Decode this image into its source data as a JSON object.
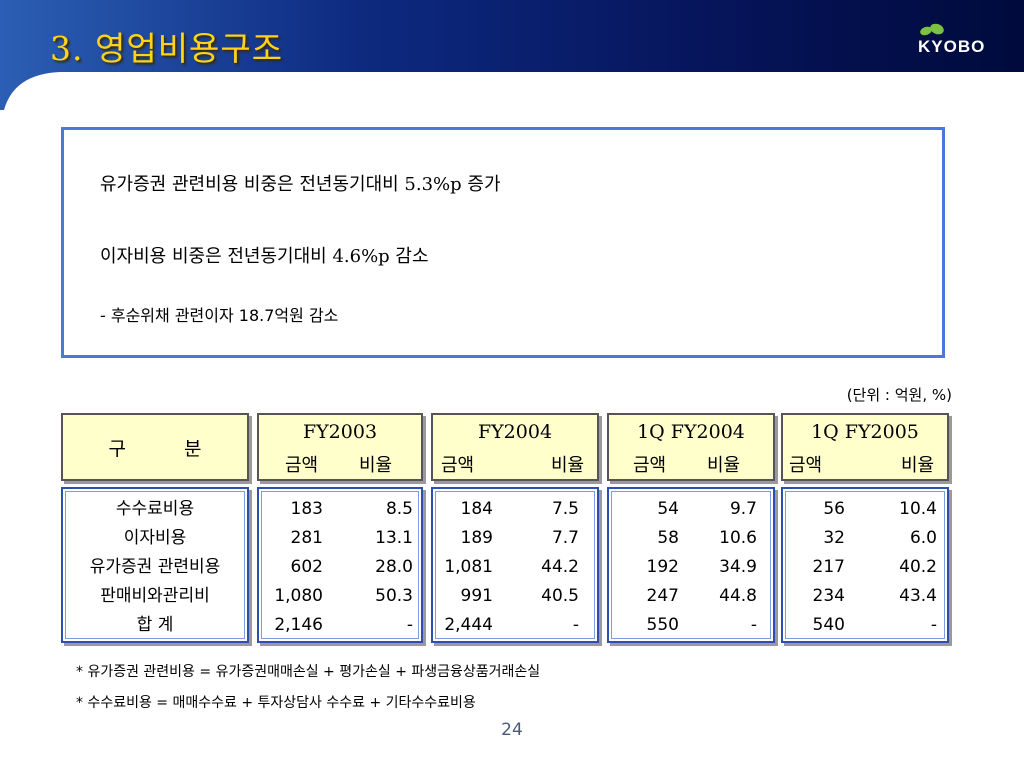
{
  "header": {
    "title": "3. 영업비용구조",
    "logo_text": "KYOBO"
  },
  "summary": {
    "line1": "유가증권 관련비용 비중은 전년동기대비 5.3%p 증가",
    "line2": "이자비용 비중은 전년동기대비 4.6%p 감소",
    "line3": "- 후순위채 관련이자 18.7억원 감소"
  },
  "table": {
    "unit": "(단위 : 억원, %)",
    "category_header": "구 분",
    "amount_label": "금액",
    "ratio_label": "비율",
    "periods": [
      "FY2003",
      "FY2004",
      "1Q FY2004",
      "1Q FY2005"
    ],
    "rows": [
      {
        "label": "수수료비용",
        "values": [
          [
            "183",
            "8.5"
          ],
          [
            "184",
            "7.5"
          ],
          [
            "54",
            "9.7"
          ],
          [
            "56",
            "10.4"
          ]
        ]
      },
      {
        "label": "이자비용",
        "values": [
          [
            "281",
            "13.1"
          ],
          [
            "189",
            "7.7"
          ],
          [
            "58",
            "10.6"
          ],
          [
            "32",
            "6.0"
          ]
        ]
      },
      {
        "label": "유가증권 관련비용",
        "values": [
          [
            "602",
            "28.0"
          ],
          [
            "1,081",
            "44.2"
          ],
          [
            "192",
            "34.9"
          ],
          [
            "217",
            "40.2"
          ]
        ]
      },
      {
        "label": "판매비와관리비",
        "values": [
          [
            "1,080",
            "50.3"
          ],
          [
            "991",
            "40.5"
          ],
          [
            "247",
            "44.8"
          ],
          [
            "234",
            "43.4"
          ]
        ]
      },
      {
        "label": "합     계",
        "values": [
          [
            "2,146",
            "-"
          ],
          [
            "2,444",
            "-"
          ],
          [
            "550",
            "-"
          ],
          [
            "540",
            "-"
          ]
        ]
      }
    ]
  },
  "notes": {
    "note1": "* 유가증권 관련비용 = 유가증권매매손실 + 평가손실 + 파생금융상품거래손실",
    "note2": "* 수수료비용 = 매매수수료 + 투자상담사 수수료 + 기타수수료비용"
  },
  "page_number": "24",
  "colors": {
    "title": "#ffd21c",
    "header_bg": "#0a1c6a",
    "box_border": "#4b78dc",
    "header_cell_bg": "#ffffcc"
  }
}
